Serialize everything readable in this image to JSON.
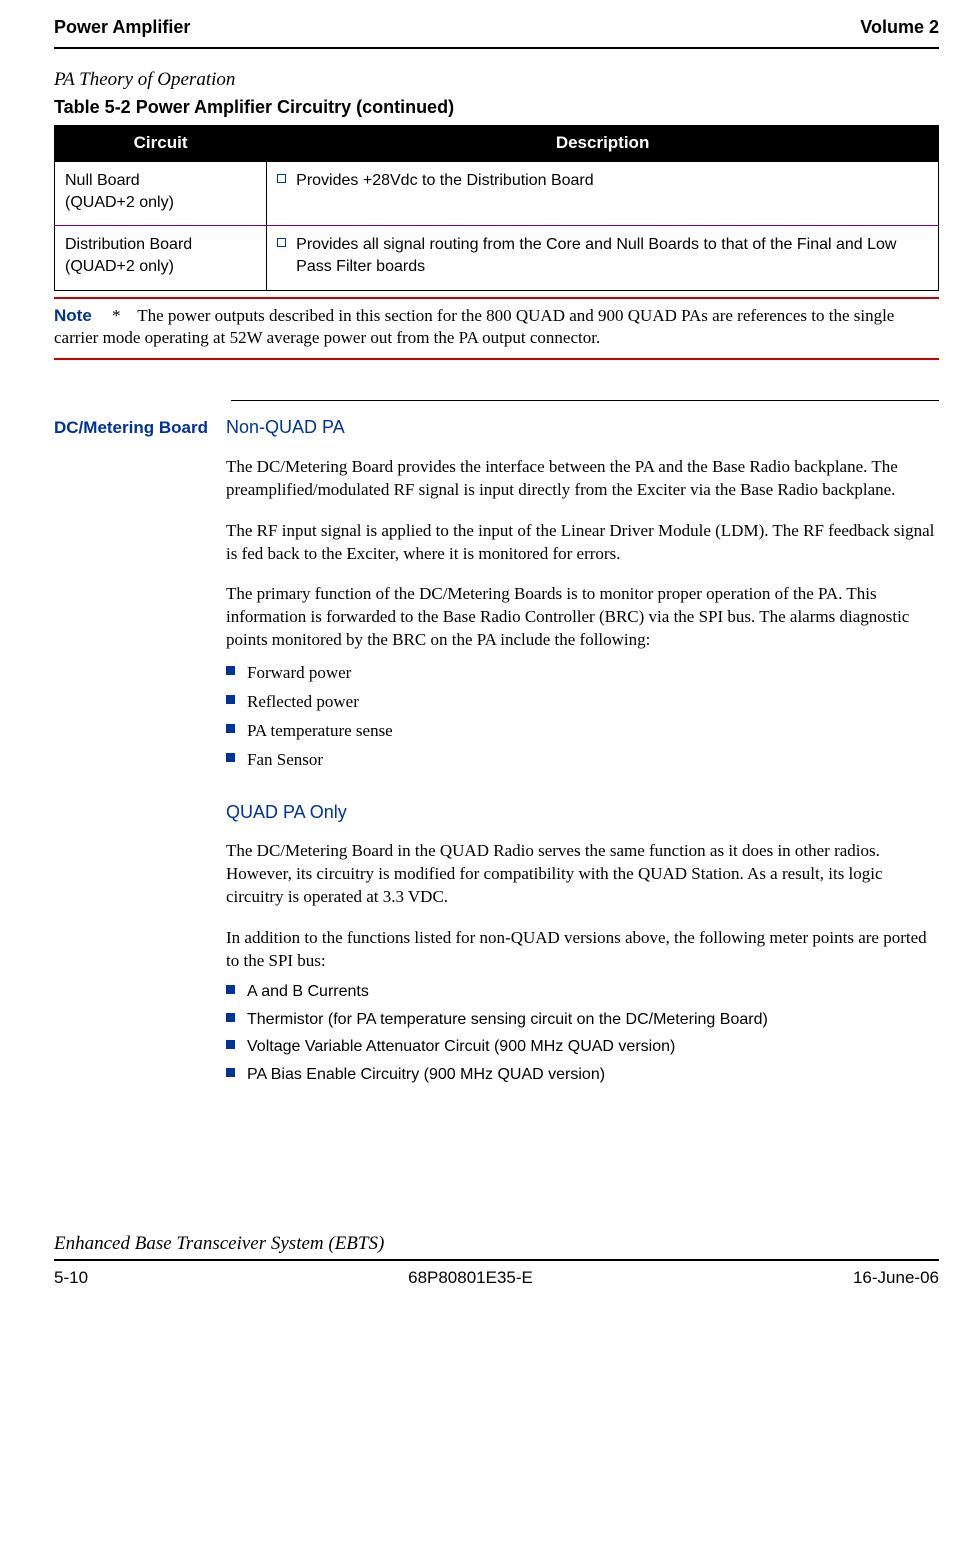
{
  "header": {
    "left": "Power Amplifier",
    "right": "Volume 2"
  },
  "section_title": "PA Theory of Operation",
  "table": {
    "caption": "Table 5-2       Power Amplifier Circuitry  (continued)",
    "headers": [
      "Circuit",
      "Description"
    ],
    "rows": [
      {
        "circuit": "Null Board",
        "circuit_note": "(QUAD+2 only)",
        "desc": "Provides +28Vdc to the Distribution Board"
      },
      {
        "circuit": "Distribution Board",
        "circuit_note": "(QUAD+2 only)",
        "desc": "Provides all signal routing from the Core and Null Boards to that of the Final and Low Pass Filter boards"
      }
    ]
  },
  "note": {
    "label": "Note",
    "marker": "*",
    "text": "The power outputs described in this section for the 800 QUAD and 900 QUAD PAs are references to the single carrier mode operating at 52W average power out from the PA output connector."
  },
  "dc": {
    "side": "DC/Metering Board",
    "s1head": "Non-QUAD PA",
    "p1": "The DC/Metering Board provides the interface between the PA and the Base Radio backplane.  The preamplified/modulated RF signal is input directly from the Exciter via the Base Radio backplane.",
    "p2": "The RF input signal is applied to the input of the Linear Driver Module (LDM). The RF feedback signal is fed back to the Exciter, where it is monitored for errors.",
    "p3": "The primary function of the DC/Metering Boards is to monitor proper operation of the PA.  This information is forwarded to the Base Radio Controller (BRC) via the SPI bus.  The alarms diagnostic points monitored by the BRC on the PA include the following:",
    "list1": [
      "Forward power",
      "Reflected power",
      "PA temperature sense",
      "Fan Sensor"
    ],
    "s2head": "QUAD PA Only",
    "p4": "The DC/Metering Board in the QUAD Radio serves the same function as it does in other radios. However, its circuitry is modified for compatibility with the QUAD Station. As a result, its logic circuitry is operated at 3.3 VDC.",
    "p5": "In addition to the functions listed for non-QUAD versions above, the following meter points are ported to the SPI bus:",
    "list2": [
      "A and B Currents",
      "Thermistor (for PA temperature sensing circuit on the DC/Metering Board)",
      "Voltage Variable Attenuator Circuit (900 MHz QUAD version)",
      "PA Bias Enable Circuitry (900 MHz QUAD version)"
    ]
  },
  "footer": {
    "title": "Enhanced Base Transceiver System (EBTS)",
    "left": "5-10",
    "center": "68P80801E35-E",
    "right": "16-June-06"
  }
}
